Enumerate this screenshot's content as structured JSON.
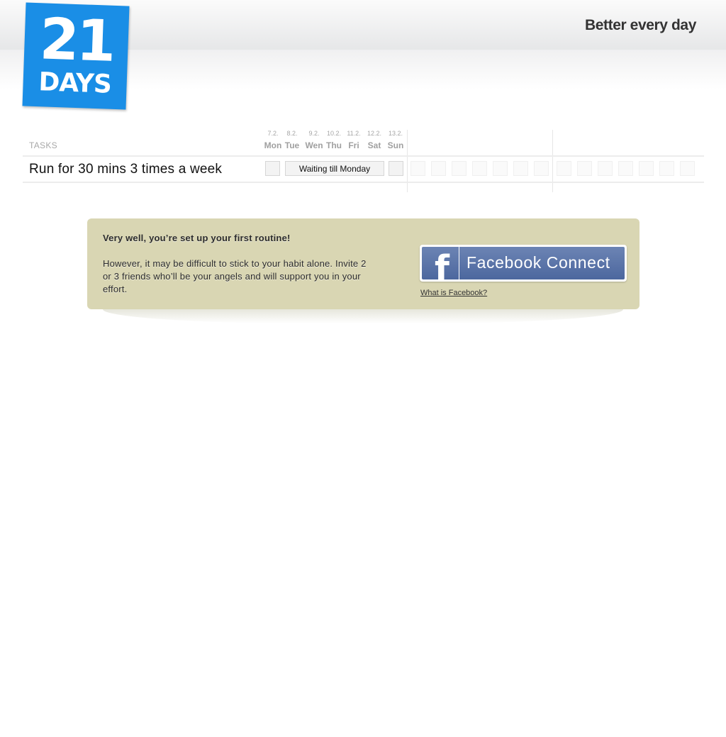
{
  "brand": {
    "logo_number": "21",
    "logo_word": "DAYS",
    "tagline": "Better every day"
  },
  "tracker": {
    "tasks_header": "TASKS",
    "days": [
      {
        "date": "7.2.",
        "name": "Mon"
      },
      {
        "date": "8.2.",
        "name": "Tue"
      },
      {
        "date": "9.2.",
        "name": "Wen"
      },
      {
        "date": "10.2.",
        "name": "Thu"
      },
      {
        "date": "11.2.",
        "name": "Fri"
      },
      {
        "date": "12.2.",
        "name": "Sat"
      },
      {
        "date": "13.2.",
        "name": "Sun"
      }
    ],
    "task": {
      "name": "Run for 30 mins 3 times a week",
      "status": "Waiting till Monday"
    }
  },
  "promo": {
    "heading": "Very well, you’re set up your first routine!",
    "body": "However, it may be difficult to stick to your habit alone. Invite 2 or 3 friends who’ll be your angels and will support you in your effort.",
    "facebook_button": "Facebook Connect",
    "facebook_logo_letter": "f",
    "help_link": "What is Facebook?"
  },
  "colors": {
    "logo_blue": "#1a8ee6",
    "panel_tan": "#d9d6b3",
    "facebook_blue": "#5a73a8"
  }
}
